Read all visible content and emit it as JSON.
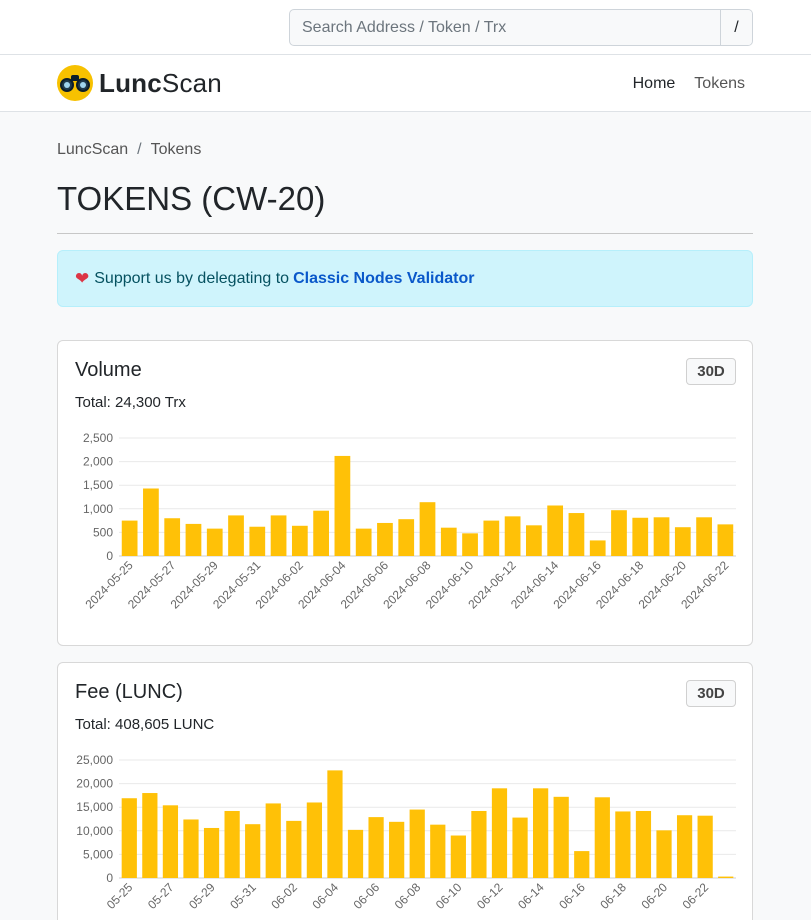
{
  "search": {
    "placeholder": "Search Address / Token / Trx",
    "button": "/"
  },
  "brand": {
    "part1": "Lunc",
    "part2": "Scan"
  },
  "nav": {
    "home": "Home",
    "tokens": "Tokens"
  },
  "breadcrumb": {
    "root": "LuncScan",
    "sep": "/",
    "current": "Tokens"
  },
  "page_title": "TOKENS (CW-20)",
  "alert": {
    "text": "Support us by delegating to",
    "link": "Classic Nodes Validator"
  },
  "accent_color": "#ffc107",
  "cards": [
    {
      "title": "Volume",
      "period": "30D",
      "total": "Total: 24,300 Trx"
    },
    {
      "title": "Fee (LUNC)",
      "period": "30D",
      "total": "Total: 408,605 LUNC"
    }
  ],
  "chart_data": [
    {
      "type": "bar",
      "x": [
        "2024-05-25",
        "2024-05-26",
        "2024-05-27",
        "2024-05-28",
        "2024-05-29",
        "2024-05-30",
        "2024-05-31",
        "2024-06-01",
        "2024-06-02",
        "2024-06-03",
        "2024-06-04",
        "2024-06-05",
        "2024-06-06",
        "2024-06-07",
        "2024-06-08",
        "2024-06-09",
        "2024-06-10",
        "2024-06-11",
        "2024-06-12",
        "2024-06-13",
        "2024-06-14",
        "2024-06-15",
        "2024-06-16",
        "2024-06-17",
        "2024-06-18",
        "2024-06-19",
        "2024-06-20",
        "2024-06-21",
        "2024-06-22"
      ],
      "x_tick_labels": [
        "2024-05-25",
        "2024-05-27",
        "2024-05-29",
        "2024-05-31",
        "2024-06-02",
        "2024-06-04",
        "2024-06-06",
        "2024-06-08",
        "2024-06-10",
        "2024-06-12",
        "2024-06-14",
        "2024-06-16",
        "2024-06-18",
        "2024-06-20",
        "2024-06-22"
      ],
      "values": [
        750,
        1430,
        800,
        680,
        580,
        860,
        620,
        860,
        640,
        960,
        2120,
        580,
        700,
        780,
        1140,
        600,
        480,
        750,
        840,
        650,
        1070,
        910,
        330,
        970,
        810,
        820,
        610,
        820,
        670
      ],
      "yticks": [
        0,
        500,
        "1,000",
        "1,500",
        "2,000",
        "2,500"
      ],
      "ylim": [
        0,
        2500
      ],
      "color": "#ffc107",
      "grid": true
    },
    {
      "type": "bar",
      "x": [
        "2024-05-25",
        "2024-05-26",
        "2024-05-27",
        "2024-05-28",
        "2024-05-29",
        "2024-05-30",
        "2024-05-31",
        "2024-06-01",
        "2024-06-02",
        "2024-06-03",
        "2024-06-04",
        "2024-06-05",
        "2024-06-06",
        "2024-06-07",
        "2024-06-08",
        "2024-06-09",
        "2024-06-10",
        "2024-06-11",
        "2024-06-12",
        "2024-06-13",
        "2024-06-14",
        "2024-06-15",
        "2024-06-16",
        "2024-06-17",
        "2024-06-18",
        "2024-06-19",
        "2024-06-20",
        "2024-06-21",
        "2024-06-22",
        "2024-06-23"
      ],
      "x_tick_labels": [
        "05-25",
        "05-27",
        "05-29",
        "05-31",
        "06-02",
        "06-04",
        "06-06",
        "06-08",
        "06-10",
        "06-12",
        "06-14",
        "06-16",
        "06-18",
        "06-20",
        "06-22"
      ],
      "values": [
        16900,
        18000,
        15400,
        12400,
        10600,
        14200,
        11400,
        15800,
        12100,
        16000,
        22800,
        10200,
        12900,
        11900,
        14500,
        11300,
        9000,
        14200,
        19000,
        12800,
        19000,
        17200,
        5700,
        17100,
        14100,
        14200,
        10100,
        13300,
        13200,
        300
      ],
      "yticks": [
        0,
        "5,000",
        "10,000",
        "15,000",
        "20,000",
        "25,000"
      ],
      "ylim": [
        0,
        25000
      ],
      "color": "#ffc107",
      "grid": true
    }
  ]
}
